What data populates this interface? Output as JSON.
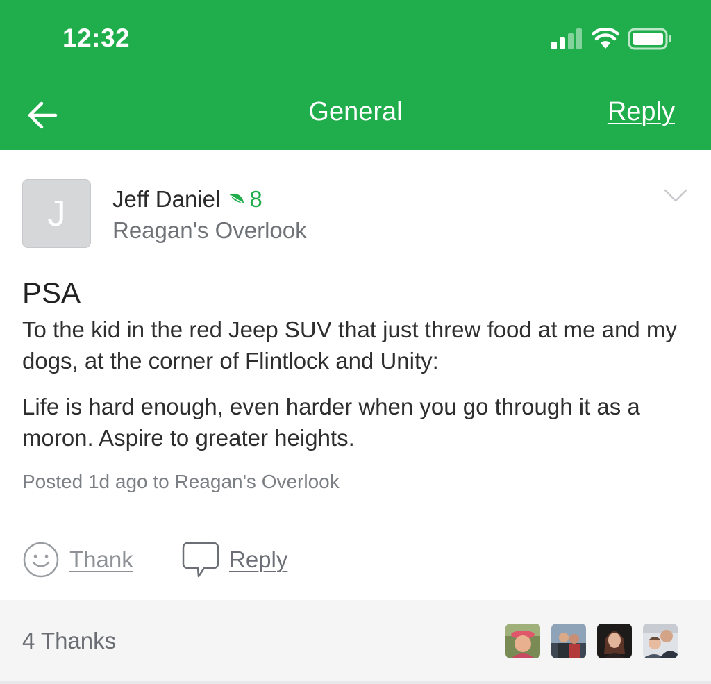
{
  "status_bar": {
    "time": "12:32",
    "icons": [
      "cellular-signal-icon",
      "wifi-icon",
      "battery-icon"
    ]
  },
  "nav": {
    "back_icon": "arrow-left-icon",
    "title": "General",
    "reply_label": "Reply"
  },
  "post": {
    "author": {
      "avatar_initial": "J",
      "name": "Jeff Daniel",
      "badge_icon": "leaf-icon",
      "badge_count": "8",
      "neighborhood": "Reagan's Overlook"
    },
    "menu_icon": "chevron-down-icon",
    "title": "PSA",
    "body": [
      "To the kid in the red Jeep SUV that just threw food at me and my dogs, at the corner of Flintlock and Unity:",
      "Life is hard enough, even harder when you go through it as a moron. Aspire to greater heights."
    ],
    "meta": "Posted 1d ago to Reagan's Overlook"
  },
  "actions": {
    "thank_label": "Thank",
    "thank_icon": "smiley-icon",
    "reply_label": "Reply",
    "reply_icon": "speech-bubble-icon"
  },
  "thanks": {
    "count_label": "4 Thanks",
    "avatars": [
      "user-photo-1",
      "user-photo-2",
      "user-photo-3",
      "user-photo-4"
    ]
  },
  "colors": {
    "brand_green": "#1fae4b",
    "text_dark": "#2b2b2b",
    "text_muted": "#6f7277",
    "thanks_bg": "#f5f5f6"
  }
}
